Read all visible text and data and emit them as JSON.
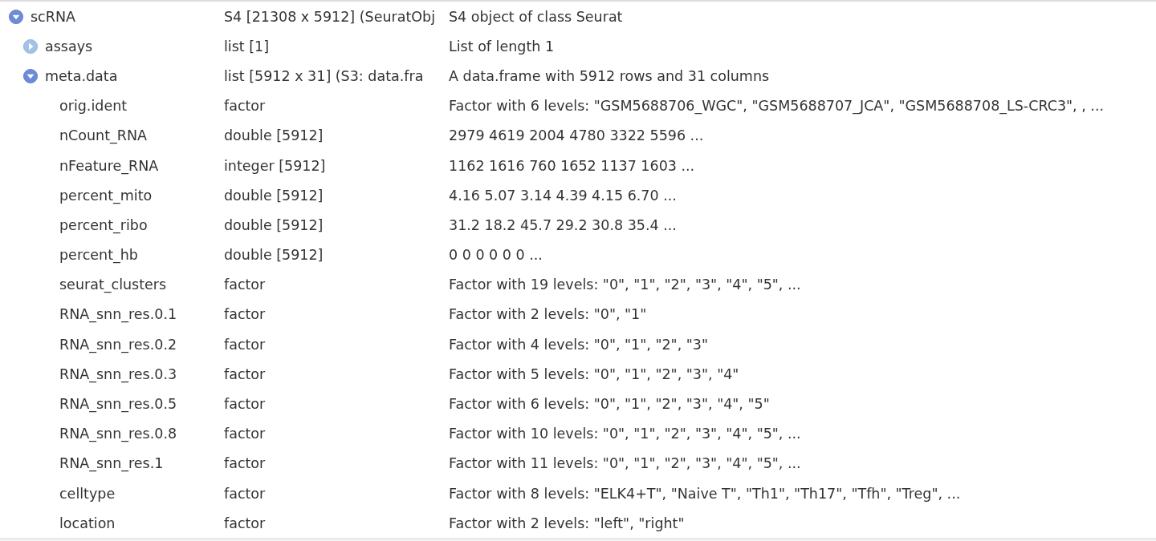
{
  "tree": [
    {
      "name": "scRNA",
      "type": "S4 [21308 x 5912] (SeuratObj",
      "value": "S4 object of class Seurat",
      "expanded": true,
      "children": [
        {
          "name": "assays",
          "type": "list [1]",
          "value": "List of length 1",
          "expanded": false
        },
        {
          "name": "meta.data",
          "type": "list [5912 x 31] (S3: data.fra",
          "value": "A data.frame with 5912 rows and 31 columns",
          "expanded": true,
          "children": [
            {
              "name": "orig.ident",
              "type": "factor",
              "value": "Factor with 6 levels: \"GSM5688706_WGC\", \"GSM5688707_JCA\", \"GSM5688708_LS-CRC3\", , ..."
            },
            {
              "name": "nCount_RNA",
              "type": "double [5912]",
              "value": "2979 4619 2004 4780 3322 5596 ..."
            },
            {
              "name": "nFeature_RNA",
              "type": "integer [5912]",
              "value": "1162 1616 760 1652 1137 1603 ..."
            },
            {
              "name": "percent_mito",
              "type": "double [5912]",
              "value": "4.16 5.07 3.14 4.39 4.15 6.70 ..."
            },
            {
              "name": "percent_ribo",
              "type": "double [5912]",
              "value": "31.2 18.2 45.7 29.2 30.8 35.4 ..."
            },
            {
              "name": "percent_hb",
              "type": "double [5912]",
              "value": "0 0 0 0 0 0 ..."
            },
            {
              "name": "seurat_clusters",
              "type": "factor",
              "value": "Factor with 19 levels: \"0\", \"1\", \"2\", \"3\", \"4\", \"5\", ..."
            },
            {
              "name": "RNA_snn_res.0.1",
              "type": "factor",
              "value": "Factor with 2 levels: \"0\", \"1\""
            },
            {
              "name": "RNA_snn_res.0.2",
              "type": "factor",
              "value": "Factor with 4 levels: \"0\", \"1\", \"2\", \"3\""
            },
            {
              "name": "RNA_snn_res.0.3",
              "type": "factor",
              "value": "Factor with 5 levels: \"0\", \"1\", \"2\", \"3\", \"4\""
            },
            {
              "name": "RNA_snn_res.0.5",
              "type": "factor",
              "value": "Factor with 6 levels: \"0\", \"1\", \"2\", \"3\", \"4\", \"5\""
            },
            {
              "name": "RNA_snn_res.0.8",
              "type": "factor",
              "value": "Factor with 10 levels: \"0\", \"1\", \"2\", \"3\", \"4\", \"5\", ..."
            },
            {
              "name": "RNA_snn_res.1",
              "type": "factor",
              "value": "Factor with 11 levels: \"0\", \"1\", \"2\", \"3\", \"4\", \"5\", ..."
            },
            {
              "name": "celltype",
              "type": "factor",
              "value": "Factor with 8 levels: \"ELK4+T\", \"Naive T\", \"Th1\", \"Th17\", \"Tfh\", \"Treg\", ..."
            },
            {
              "name": "location",
              "type": "factor",
              "value": "Factor with 2 levels: \"left\", \"right\""
            }
          ]
        }
      ]
    }
  ]
}
